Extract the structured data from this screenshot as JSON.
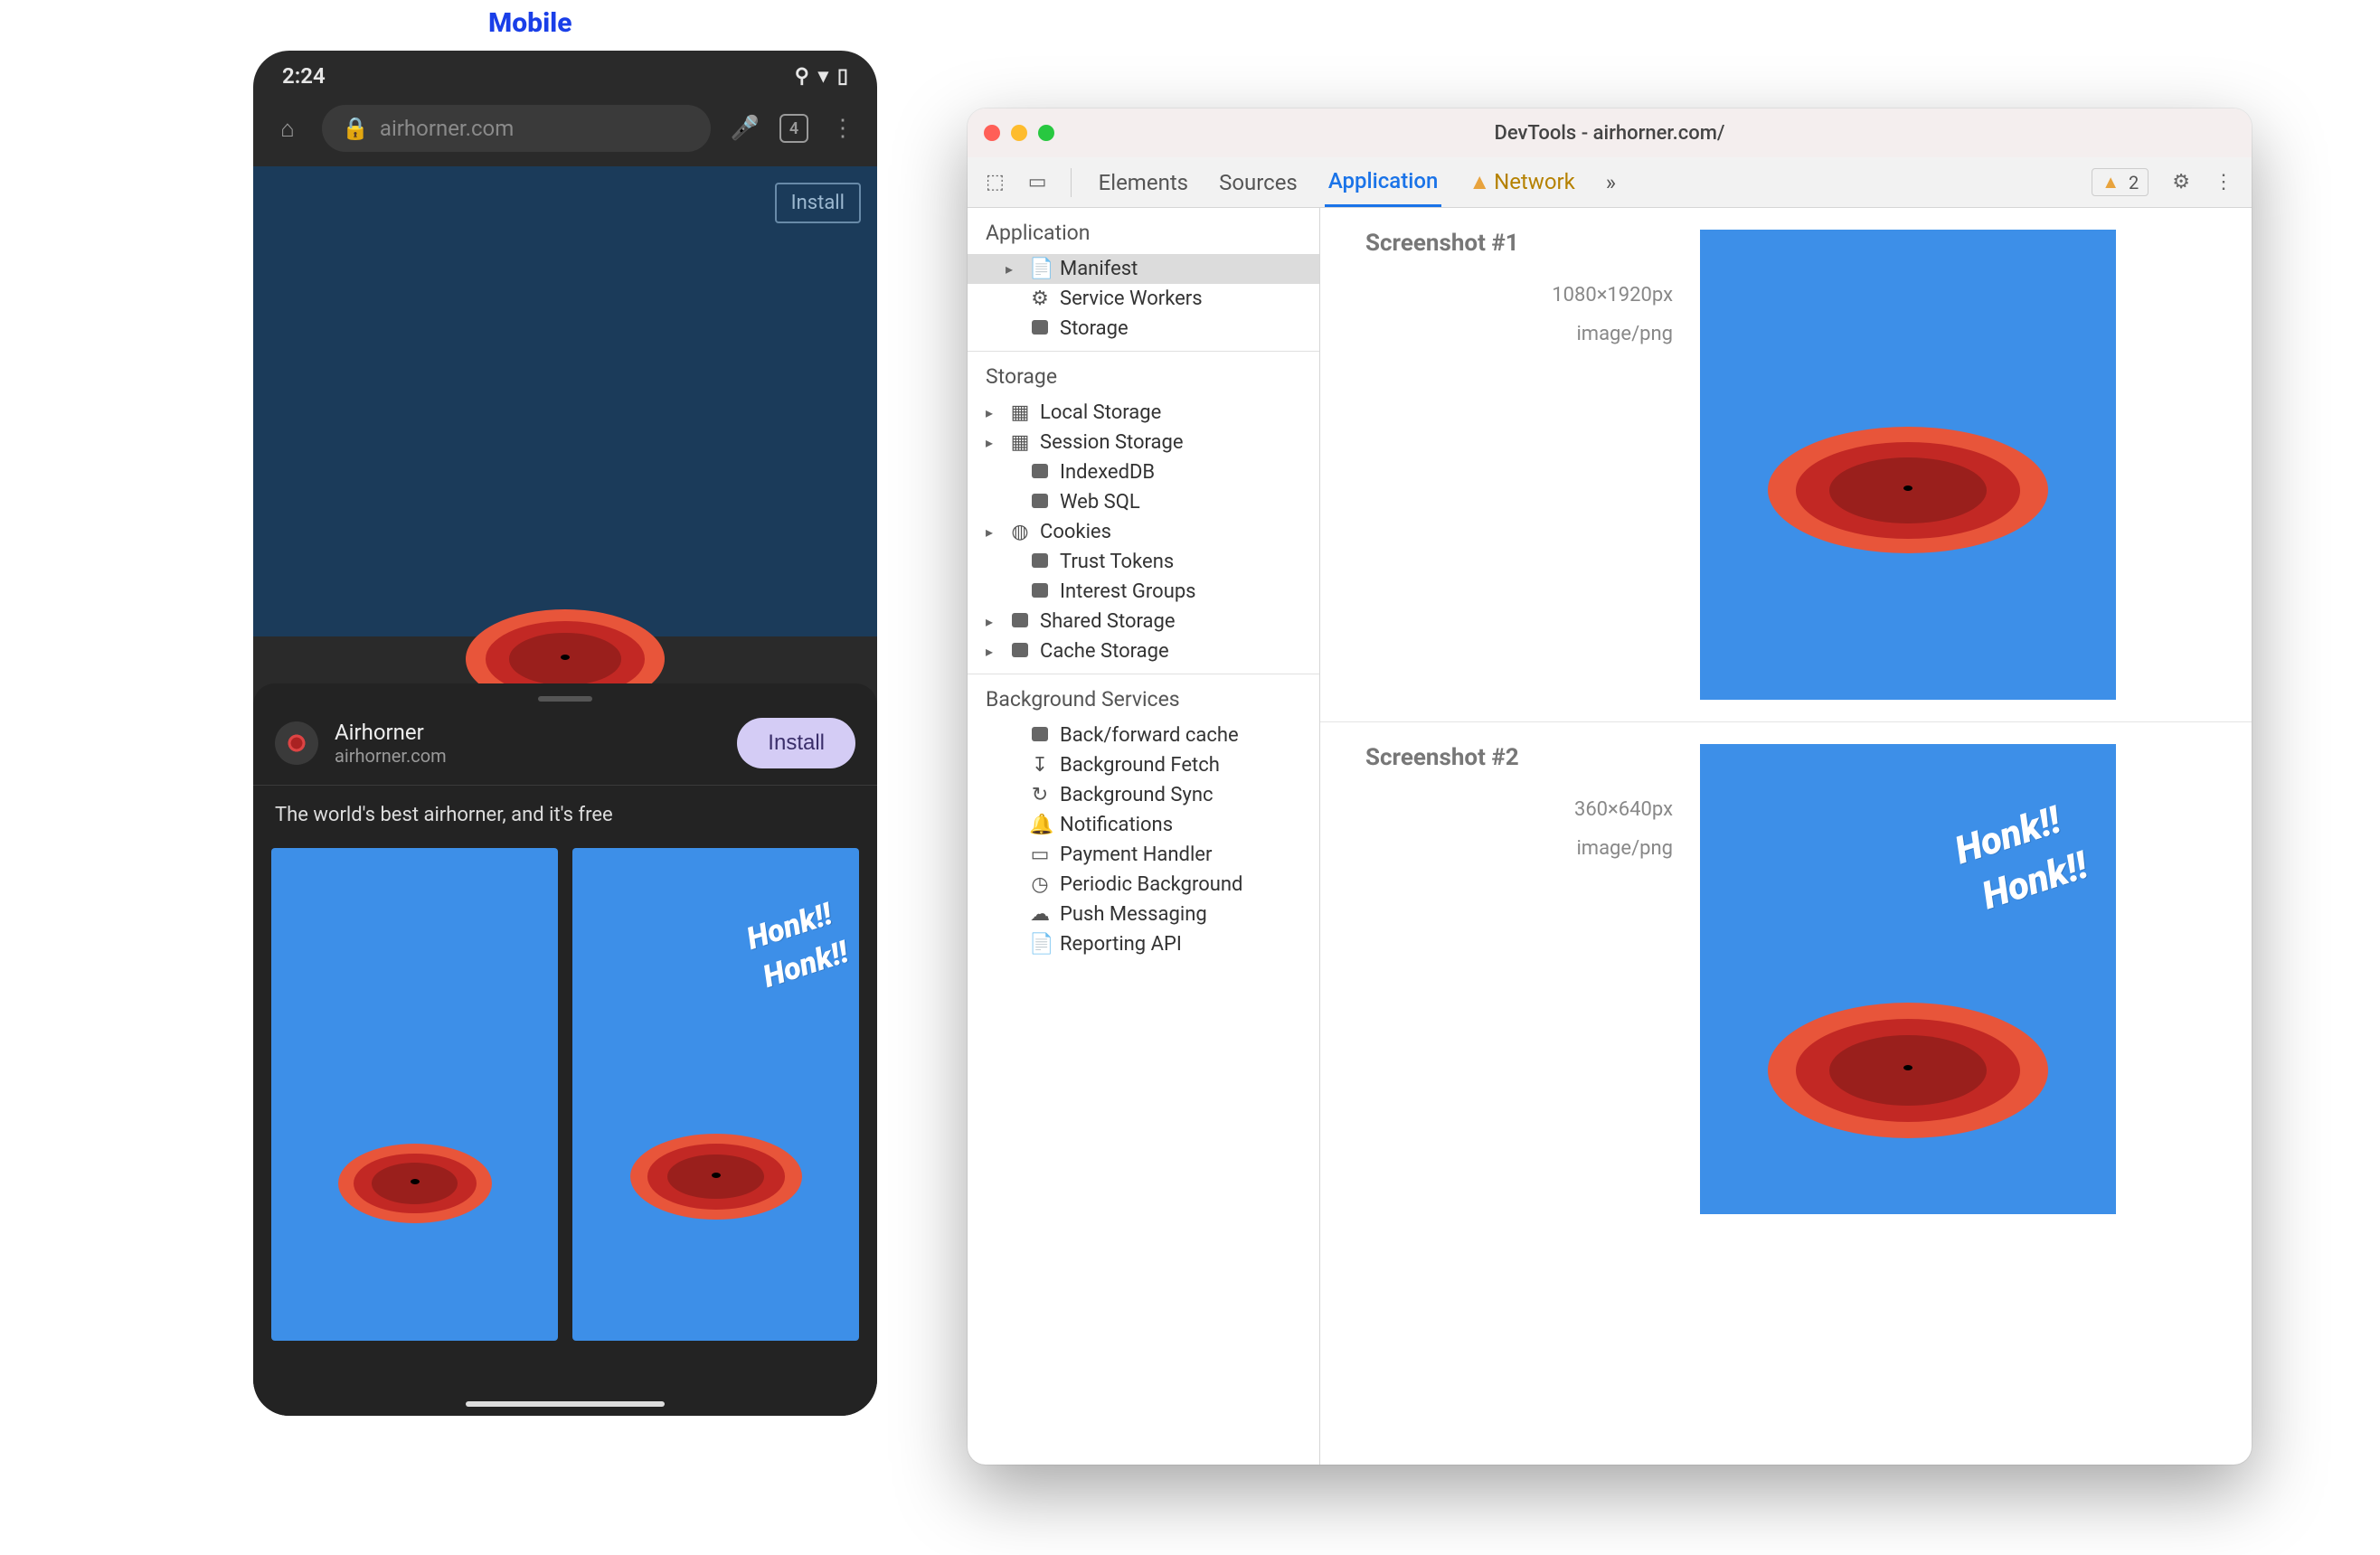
{
  "label": "Mobile",
  "phone": {
    "time": "2:24",
    "url": "airhorner.com",
    "tabs_count": "4",
    "install_outline": "Install",
    "sheet": {
      "app_name": "Airhorner",
      "app_domain": "airhorner.com",
      "install": "Install",
      "desc": "The world's best airhorner, and it's free",
      "honk1": "Honk!!",
      "honk2": "Honk!!"
    }
  },
  "devtools": {
    "title": "DevTools - airhorner.com/",
    "tabs": {
      "elements": "Elements",
      "sources": "Sources",
      "application": "Application",
      "network": "Network",
      "more": "»",
      "warn_count": "2"
    },
    "sidebar": {
      "application": {
        "title": "Application",
        "items": [
          "Manifest",
          "Service Workers",
          "Storage"
        ]
      },
      "storage": {
        "title": "Storage",
        "items": [
          "Local Storage",
          "Session Storage",
          "IndexedDB",
          "Web SQL",
          "Cookies",
          "Trust Tokens",
          "Interest Groups",
          "Shared Storage",
          "Cache Storage"
        ]
      },
      "background": {
        "title": "Background Services",
        "items": [
          "Back/forward cache",
          "Background Fetch",
          "Background Sync",
          "Notifications",
          "Payment Handler",
          "Periodic Background",
          "Push Messaging",
          "Reporting API"
        ]
      }
    },
    "screenshots": [
      {
        "title": "Screenshot #1",
        "dims": "1080×1920px",
        "mime": "image/png"
      },
      {
        "title": "Screenshot #2",
        "dims": "360×640px",
        "mime": "image/png",
        "honk1": "Honk!!",
        "honk2": "Honk!!"
      }
    ]
  }
}
